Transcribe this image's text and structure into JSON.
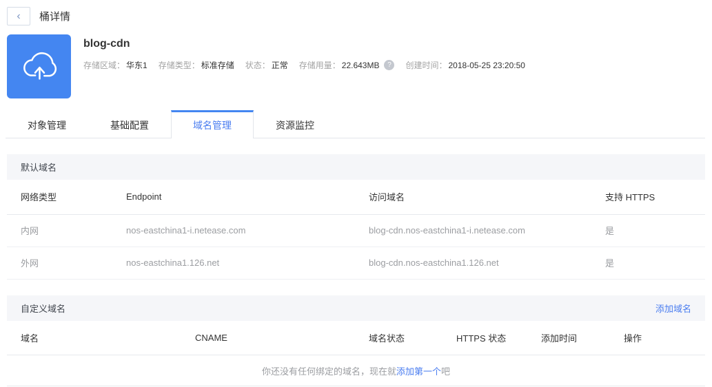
{
  "topbar": {
    "back_icon": "‹",
    "title": "桶详情"
  },
  "bucket": {
    "name": "blog-cdn",
    "meta": [
      {
        "label": "存储区域：",
        "value": "华东1"
      },
      {
        "label": "存储类型：",
        "value": "标准存储"
      },
      {
        "label": "状态：",
        "value": "正常"
      },
      {
        "label": "存储用量：",
        "value": "22.643MB"
      },
      {
        "label": "创建时间：",
        "value": "2018-05-25 23:20:50"
      }
    ],
    "help_icon": "?"
  },
  "tabs": [
    {
      "label": "对象管理"
    },
    {
      "label": "基础配置"
    },
    {
      "label": "域名管理"
    },
    {
      "label": "资源监控"
    }
  ],
  "active_tab": "域名管理",
  "default_domain": {
    "section_title": "默认域名",
    "columns": [
      "网络类型",
      "Endpoint",
      "访问域名",
      "支持 HTTPS"
    ],
    "rows": [
      [
        "内网",
        "nos-eastchina1-i.netease.com",
        "blog-cdn.nos-eastchina1-i.netease.com",
        "是"
      ],
      [
        "外网",
        "nos-eastchina1.126.net",
        "blog-cdn.nos-eastchina1.126.net",
        "是"
      ]
    ]
  },
  "custom_domain": {
    "section_title": "自定义域名",
    "add_link": "添加域名",
    "columns": [
      "域名",
      "CNAME",
      "域名状态",
      "HTTPS 状态",
      "添加时间",
      "操作"
    ],
    "empty": {
      "prefix": "你还没有任何绑定的域名，现在就",
      "link": "添加第一个",
      "suffix": "吧"
    }
  },
  "colors": {
    "accent": "#4486f1",
    "link": "#4a7df0",
    "section_bg": "#f5f6f9"
  }
}
